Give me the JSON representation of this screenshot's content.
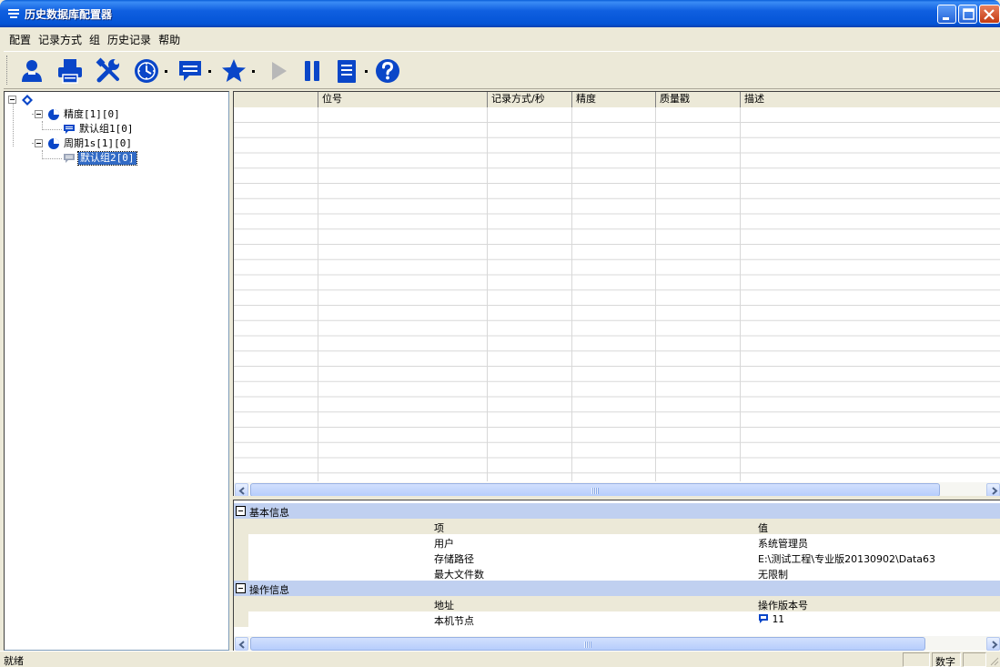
{
  "window": {
    "title": "历史数据库配置器",
    "controls": [
      "minimize-icon",
      "maximize-icon",
      "close-icon"
    ]
  },
  "menu": {
    "items": [
      "配置",
      "记录方式",
      "组",
      "历史记录",
      "帮助"
    ]
  },
  "toolbar": {
    "buttons": [
      "user-icon",
      "print-icon",
      "tools-icon",
      "clock-icon",
      "comment-icon",
      "star-icon",
      "play-icon",
      "pause-icon",
      "list-icon",
      "help-icon"
    ]
  },
  "tree": {
    "root_icon": "diamond-icon",
    "nodes": [
      {
        "label": "精度[1][0]",
        "icon": "pie-icon",
        "children": [
          {
            "label": "默认组1[0]",
            "icon": "comment-icon"
          }
        ]
      },
      {
        "label": "周期1s[1][0]",
        "icon": "pie-icon",
        "children": [
          {
            "label": "默认组2[0]",
            "icon": "comment-icon",
            "selected": true
          }
        ]
      }
    ]
  },
  "grid": {
    "columns": [
      "",
      "位号",
      "记录方式/秒",
      "精度",
      "质量戳",
      "描述"
    ],
    "rows": []
  },
  "properties": {
    "categories": [
      {
        "label": "基本信息",
        "header": {
          "key": "项",
          "value": "值"
        },
        "rows": [
          {
            "key": "用户",
            "value": "系统管理员"
          },
          {
            "key": "存储路径",
            "value": "E:\\测试工程\\专业版20130902\\Data63"
          },
          {
            "key": "最大文件数",
            "value": "无限制"
          }
        ]
      },
      {
        "label": "操作信息",
        "header": {
          "key": "地址",
          "value": "操作版本号"
        },
        "rows": [
          {
            "key": "本机节点",
            "value": "11",
            "icon": "comment-icon"
          }
        ]
      }
    ]
  },
  "statusbar": {
    "text": "就绪",
    "panes": [
      "",
      "数字",
      ""
    ]
  },
  "colors": {
    "titlebar": "#0454d6",
    "selection": "#316ac5",
    "category_bg": "#c0d0f0",
    "icon_blue": "#0a46c8"
  }
}
